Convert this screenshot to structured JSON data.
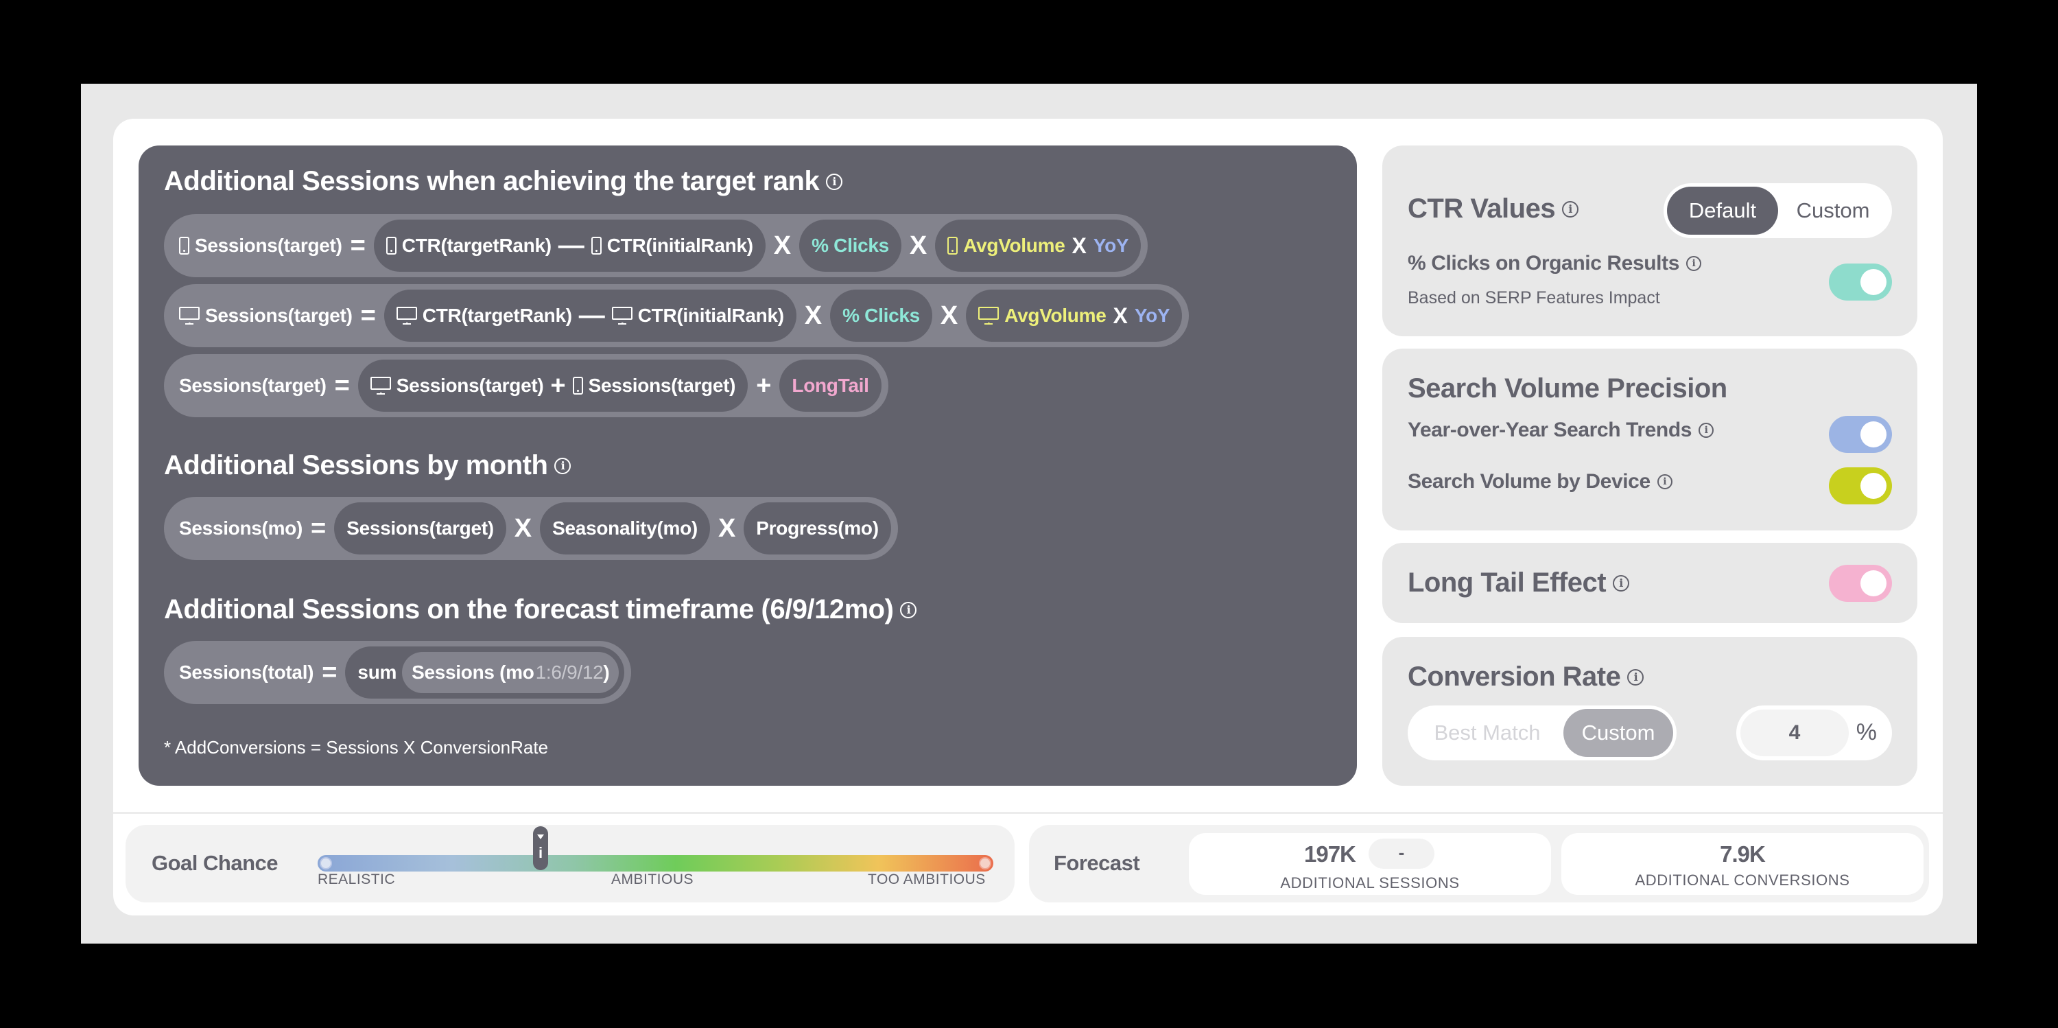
{
  "formula_panel": {
    "section1": {
      "title": "Additional Sessions when achieving the target rank",
      "rows": [
        {
          "device": "mobile",
          "lhs": "Sessions(target)",
          "eq": "=",
          "ctr_target": "CTR(targetRank)",
          "minus": "—",
          "ctr_initial": "CTR(initialRank)",
          "times1": "X",
          "clicks": "% Clicks",
          "times2": "X",
          "avgvolume": "AvgVolume",
          "times3": "X",
          "yoy": "YoY"
        },
        {
          "device": "desktop",
          "lhs": "Sessions(target)",
          "eq": "=",
          "ctr_target": "CTR(targetRank)",
          "minus": "—",
          "ctr_initial": "CTR(initialRank)",
          "times1": "X",
          "clicks": "% Clicks",
          "times2": "X",
          "avgvolume": "AvgVolume",
          "times3": "X",
          "yoy": "YoY"
        }
      ],
      "total_row": {
        "lhs": "Sessions(target)",
        "eq": "=",
        "desktop_term": "Sessions(target)",
        "plus1": "+",
        "mobile_term": "Sessions(target)",
        "plus2": "+",
        "longtail": "LongTail"
      }
    },
    "section2": {
      "title": "Additional Sessions by month",
      "row": {
        "lhs": "Sessions(mo)",
        "eq": "=",
        "t1": "Sessions(target)",
        "times1": "X",
        "t2": "Seasonality(mo)",
        "times2": "X",
        "t3": "Progress(mo)"
      }
    },
    "section3": {
      "title": "Additional Sessions on the forecast timeframe (6/9/12mo)",
      "row": {
        "lhs": "Sessions(total)",
        "eq": "=",
        "sum": "sum",
        "term": "Sessions (mo",
        "range": "1:6/9/12",
        "close": ")"
      }
    },
    "footnote": "* AddConversions = Sessions X ConversionRate"
  },
  "ctr_values": {
    "title": "CTR Values",
    "options": [
      "Default",
      "Custom"
    ],
    "selected": "Default",
    "clicks_label": "% Clicks on Organic Results",
    "clicks_sub": "Based on SERP Features Impact",
    "clicks_enabled": true,
    "clicks_color": "#8edccc"
  },
  "search_volume_precision": {
    "title": "Search Volume Precision",
    "items": [
      {
        "label": "Year-over-Year Search Trends",
        "enabled": true,
        "color": "#9cb4e4"
      },
      {
        "label": "Search Volume by Device",
        "enabled": true,
        "color": "#c8d01e"
      }
    ]
  },
  "long_tail": {
    "title": "Long Tail Effect",
    "enabled": true,
    "color": "#f5b2d0"
  },
  "conversion_rate": {
    "title": "Conversion Rate",
    "options": [
      "Best Match",
      "Custom"
    ],
    "selected": "Custom",
    "value": "4",
    "unit": "%"
  },
  "goal_chance": {
    "label": "Goal Chance",
    "scale_labels": [
      "REALISTIC",
      "AMBITIOUS",
      "TOO AMBITIOUS"
    ],
    "position_fraction": 0.33
  },
  "forecast": {
    "label": "Forecast",
    "sessions_value": "197K",
    "sessions_delta": "-",
    "sessions_caption": "ADDITIONAL SESSIONS",
    "conversions_value": "7.9K",
    "conversions_caption": "ADDITIONAL CONVERSIONS"
  }
}
